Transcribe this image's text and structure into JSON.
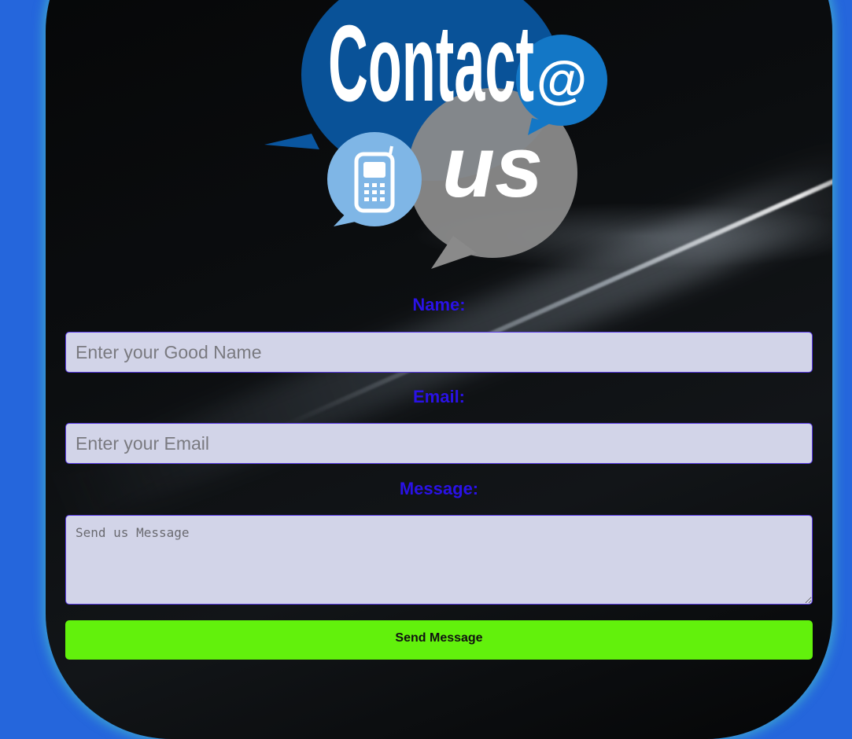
{
  "logo": {
    "word_contact": "Contact",
    "at_symbol": "@",
    "word_us": "us"
  },
  "form": {
    "name_label": "Name:",
    "name_placeholder": "Enter your Good Name",
    "email_label": "Email:",
    "email_placeholder": "Enter your Email",
    "message_label": "Message:",
    "message_placeholder": "Send us Message",
    "submit_label": "Send Message"
  },
  "colors": {
    "page_background": "#2566dc",
    "label_color": "#2a12e6",
    "input_background": "#d2d4e8",
    "submit_background": "#62f10c"
  }
}
